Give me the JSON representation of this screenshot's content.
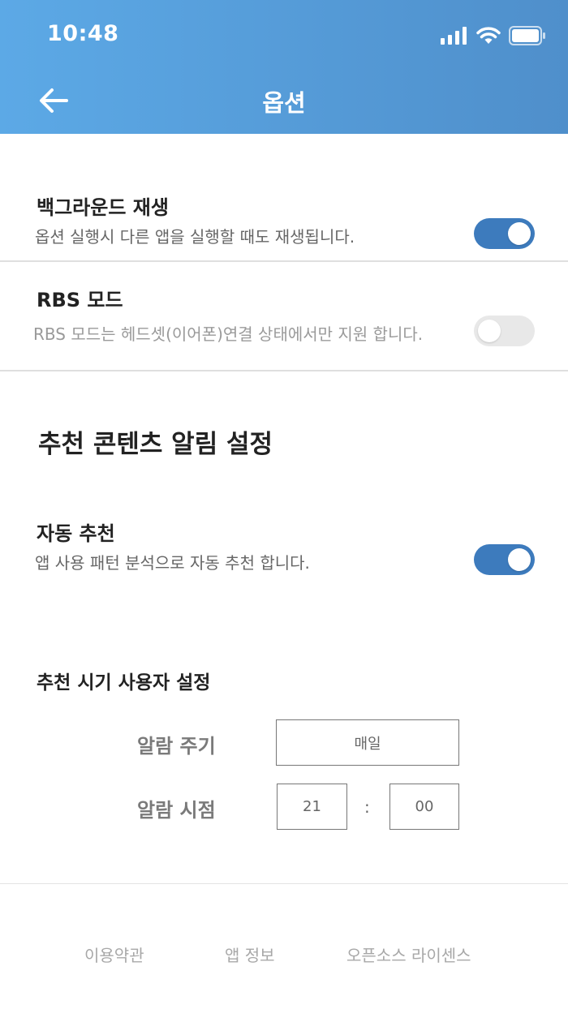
{
  "status_bar": {
    "time": "10:48"
  },
  "header": {
    "title": "옵션"
  },
  "settings": {
    "background_play": {
      "title": "백그라운드 재생",
      "description": "옵션 실행시 다른 앱을 실행할 때도 재생됩니다.",
      "enabled": true
    },
    "rbs_mode": {
      "title": "RBS 모드",
      "description": "RBS 모드는 헤드셋(이어폰)연결 상태에서만 지원 합니다.",
      "enabled": false
    }
  },
  "recommend": {
    "section_title": "추천 콘텐츠 알림 설정",
    "auto": {
      "title": "자동 추천",
      "description": "앱 사용 패턴 분석으로 자동 추천 합니다.",
      "enabled": true
    },
    "custom_title": "추천 시기 사용자 설정",
    "alarm_cycle_label": "알람 주기",
    "alarm_cycle_value": "매일",
    "alarm_time_label": "알람 시점",
    "alarm_hour": "21",
    "alarm_separator": ":",
    "alarm_minute": "00"
  },
  "footer": {
    "terms": "이용약관",
    "app_info": "앱 정보",
    "open_source": "오픈소스 라이센스"
  },
  "colors": {
    "accent": "#3d7bbd",
    "header_start": "#5ca9e6",
    "header_end": "#4f8fcb"
  },
  "icons": {
    "back": "arrow-left-icon",
    "signal": "signal-icon",
    "wifi": "wifi-icon",
    "battery": "battery-icon"
  }
}
